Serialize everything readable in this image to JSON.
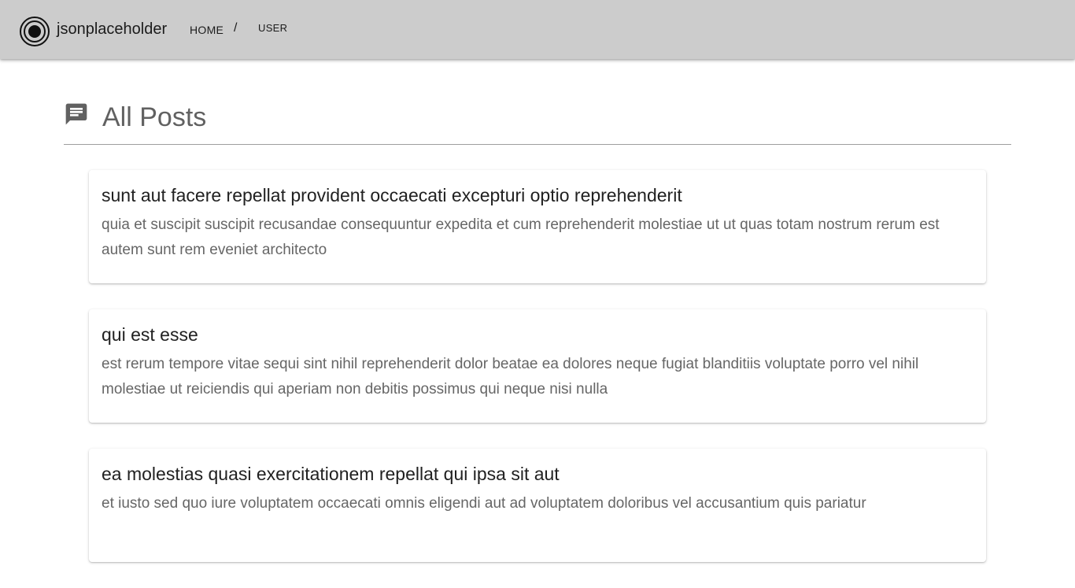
{
  "appbar": {
    "brand": "jsonplaceholder",
    "breadcrumb": {
      "home": "HOME",
      "separator": "/",
      "current": "USER"
    },
    "background": "#cccccc"
  },
  "page": {
    "title": "All Posts",
    "icon": "message-icon"
  },
  "posts": [
    {
      "title": "sunt aut facere repellat provident occaecati excepturi optio reprehenderit",
      "body": "quia et suscipit suscipit recusandae consequuntur expedita et cum reprehenderit molestiae ut ut quas totam nostrum rerum est autem sunt rem eveniet architecto"
    },
    {
      "title": "qui est esse",
      "body": "est rerum tempore vitae sequi sint nihil reprehenderit dolor beatae ea dolores neque fugiat blanditiis voluptate porro vel nihil molestiae ut reiciendis qui aperiam non debitis possimus qui neque nisi nulla"
    },
    {
      "title": "ea molestias quasi exercitationem repellat qui ipsa sit aut",
      "body": "et iusto sed quo iure voluptatem occaecati omnis eligendi aut ad voluptatem doloribus vel accusantium quis pariatur"
    }
  ]
}
